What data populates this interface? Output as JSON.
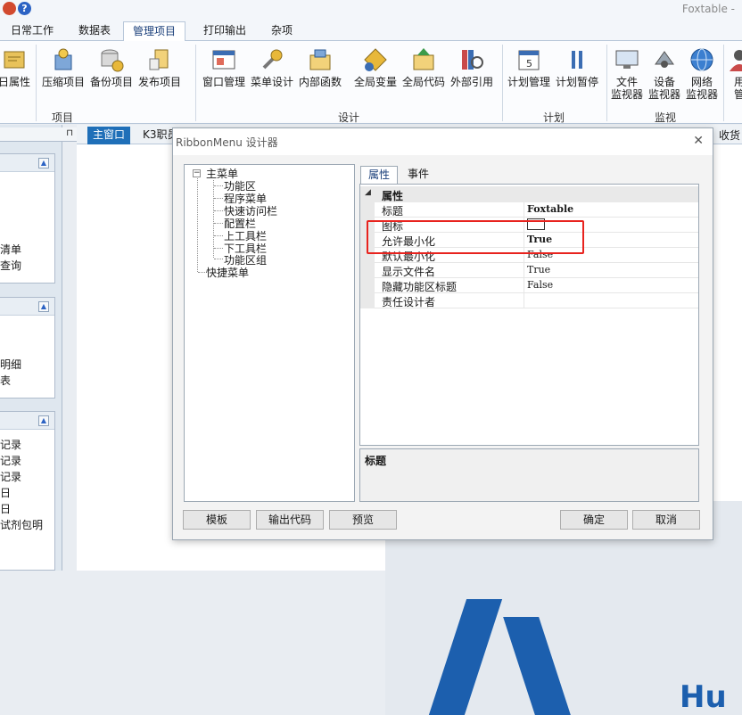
{
  "app": {
    "title": "Foxtable -"
  },
  "ribbon_tabs": [
    "日常工作",
    "数据表",
    "管理项目",
    "打印输出",
    "杂项"
  ],
  "active_tab": "管理项目",
  "ribbon": {
    "partial_left_button": "日属性",
    "groups": [
      {
        "label": "项目",
        "buttons": [
          "压缩项目",
          "备份项目",
          "发布项目"
        ]
      },
      {
        "label": "设计",
        "buttons": [
          "窗口管理",
          "菜单设计",
          "内部函数",
          "全局变量",
          "全局代码",
          "外部引用"
        ]
      },
      {
        "label": "计划",
        "buttons": [
          "计划管理",
          "计划暂停"
        ]
      },
      {
        "label": "监视",
        "buttons": [
          "文件\n监视器",
          "设备\n监视器",
          "网络\n监视器"
        ]
      }
    ],
    "partial_right_button": "用\n管"
  },
  "left_panel": {
    "card1_items": [
      "清单",
      "查询"
    ],
    "card2_items": [
      "明细",
      "表"
    ],
    "card3_items": [
      "记录",
      "记录",
      "记录",
      "日",
      "日",
      "试剂包明"
    ]
  },
  "doc_tabs": {
    "active": "主窗口",
    "second": "K3职员",
    "right_partial": "收货"
  },
  "background_logo_text": "Hu",
  "dialog": {
    "title": "RibbonMenu 设计器",
    "close_glyph": "✕",
    "tree": {
      "root": "主菜单",
      "children": [
        "功能区",
        "程序菜单",
        "快速访问栏",
        "配置栏",
        "上工具栏",
        "下工具栏",
        "功能区组"
      ],
      "sibling": "快捷菜单"
    },
    "prop_tabs": [
      "属性",
      "事件"
    ],
    "active_prop_tab": "属性",
    "category": "属性",
    "properties": [
      {
        "name": "标题",
        "value": "Foxtable",
        "bold": true
      },
      {
        "name": "图标",
        "value": "",
        "is_color": true
      },
      {
        "name": "允许最小化",
        "value": "True",
        "bold": true
      },
      {
        "name": "默认最小化",
        "value": "False",
        "bold": false
      },
      {
        "name": "显示文件名",
        "value": "True",
        "bold": false
      },
      {
        "name": "隐藏功能区标题",
        "value": "False",
        "bold": false
      },
      {
        "name": "责任设计者",
        "value": "",
        "bold": false
      }
    ],
    "description_title": "标题",
    "buttons": {
      "template": "模板",
      "export_code": "输出代码",
      "preview": "预览",
      "ok": "确定",
      "cancel": "取消"
    }
  },
  "colors": {
    "accent": "#1f6fb8",
    "highlight": "#e8231e"
  }
}
